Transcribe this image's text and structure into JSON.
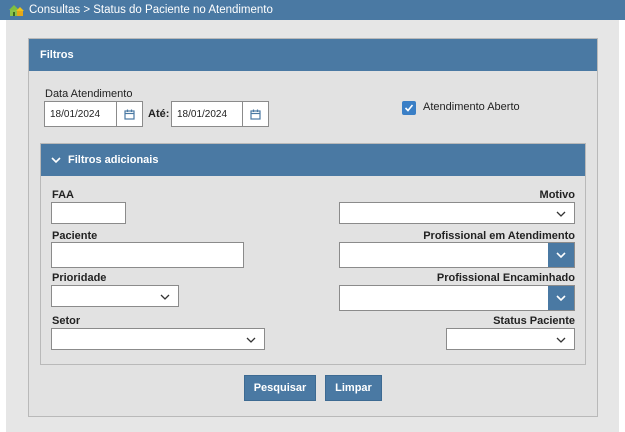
{
  "titlebar": {
    "breadcrumb": "Consultas > Status do Paciente no Atendimento",
    "icon": "home-icon"
  },
  "filters": {
    "header": "Filtros",
    "date_label": "Data Atendimento",
    "date_from": "18/01/2024",
    "ate_label": "Até:",
    "date_to": "18/01/2024",
    "open_care_label": "Atendimento Aberto",
    "open_care_checked": true
  },
  "additional": {
    "header": "Filtros adicionais",
    "faa_label": "FAA",
    "faa_value": "",
    "motivo_label": "Motivo",
    "motivo_value": "",
    "paciente_label": "Paciente",
    "paciente_value": "",
    "prof_atendimento_label": "Profissional em Atendimento",
    "prof_atendimento_value": "",
    "prioridade_label": "Prioridade",
    "prioridade_value": "",
    "prof_encaminhado_label": "Profissional Encaminhado",
    "prof_encaminhado_value": "",
    "setor_label": "Setor",
    "setor_value": "",
    "status_label": "Status Paciente",
    "status_value": ""
  },
  "actions": {
    "search_label": "Pesquisar",
    "clear_label": "Limpar"
  },
  "colors": {
    "accent": "#4a79a3",
    "checkbox": "#3a7fc6"
  }
}
